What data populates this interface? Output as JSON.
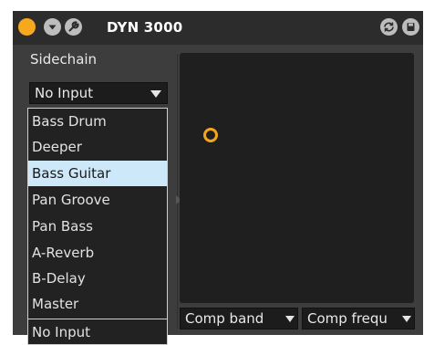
{
  "device": {
    "title": "DYN 3000"
  },
  "sidechain": {
    "label": "Sidechain",
    "selected": "No Input",
    "options": [
      "Bass Drum",
      "Deeper",
      "Bass Guitar",
      "Pan Groove",
      "Pan Bass",
      "A-Reverb",
      "B-Delay",
      "Master"
    ],
    "highlighted": "Bass Guitar",
    "footer_option": "No Input"
  },
  "bottom_selectors": {
    "left": "Comp band",
    "right": "Comp frequ"
  },
  "colors": {
    "accent": "#f7a91d",
    "selection": "#cde8f8"
  },
  "icons": [
    "power-icon",
    "chevron-down-icon",
    "wrench-icon",
    "swap-icon",
    "save-icon",
    "chevron-down-icon"
  ]
}
